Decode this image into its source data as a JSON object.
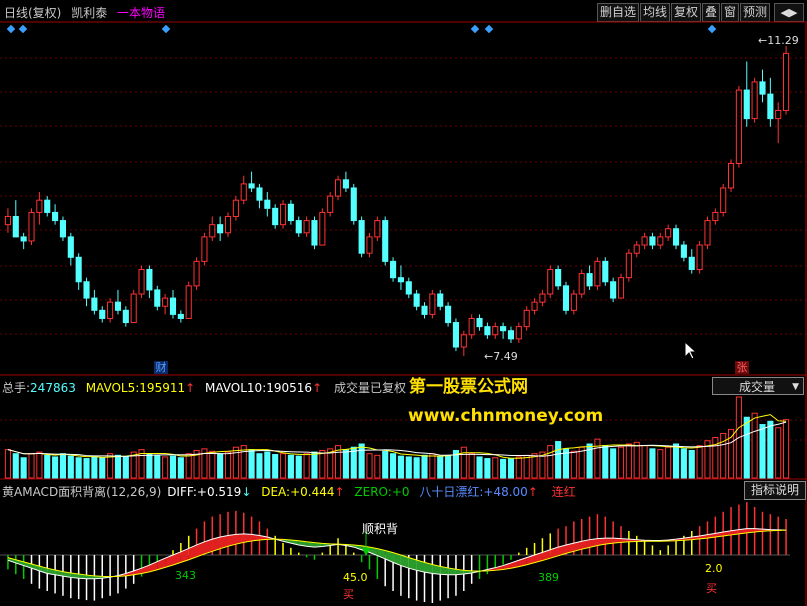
{
  "title": {
    "period": "日线(复权)",
    "stock": "凯利泰",
    "slogan": "一本物语"
  },
  "toolbar": [
    "删自选",
    "均线",
    "复权",
    "叠",
    "窗",
    "预测"
  ],
  "price": {
    "high_label": "11.29",
    "low_label": "7.49",
    "event_cai": "财",
    "event_zhang": "张"
  },
  "volume_info": {
    "total_label": "总手:",
    "total": "247863",
    "ma5_label": "MAVOL5:",
    "ma5": "195911",
    "ma10_label": "MAVOL10:",
    "ma10": "190516",
    "note": "成交量已复权",
    "selector": "成交量"
  },
  "indicator_info": {
    "name": "黄AMACD面积背离(12,26,9)",
    "diff_label": "DIFF:",
    "diff": "+0.519",
    "dea_label": "DEA:",
    "dea": "+0.444",
    "zero_label": "ZERO:",
    "zero": "+0",
    "red_label": "八十日漂红:",
    "red": "+48.00",
    "lianhong": "连红",
    "help": "指标说明"
  },
  "macd_labels": {
    "shunjibei": "顺积背",
    "a343": "343",
    "a45": "45.0",
    "a389": "389",
    "a2": "2.0",
    "mai": "买",
    "mai2": "买"
  },
  "watermark": {
    "name": "第一股票公式网",
    "url": "www.chnmoney.com"
  },
  "colors": {
    "up": "#ff3232",
    "down": "#54ffff",
    "white": "#ffffff",
    "yellow": "#ffff00",
    "magenta": "#ff00ff",
    "grid": "#6e0000"
  },
  "chart_data": {
    "type": "candlestick",
    "price_range": [
      7.49,
      11.29
    ],
    "candles": [
      [
        9.1,
        9.3,
        9.0,
        9.2
      ],
      [
        9.2,
        9.4,
        9.1,
        8.95
      ],
      [
        8.95,
        9.0,
        8.8,
        8.9
      ],
      [
        8.9,
        9.3,
        8.85,
        9.25
      ],
      [
        9.25,
        9.5,
        9.1,
        9.4
      ],
      [
        9.4,
        9.45,
        9.2,
        9.25
      ],
      [
        9.25,
        9.35,
        9.1,
        9.15
      ],
      [
        9.15,
        9.2,
        8.9,
        8.95
      ],
      [
        8.95,
        9.0,
        8.6,
        8.7
      ],
      [
        8.7,
        8.75,
        8.3,
        8.4
      ],
      [
        8.4,
        8.45,
        8.1,
        8.2
      ],
      [
        8.2,
        8.3,
        8.0,
        8.05
      ],
      [
        8.05,
        8.1,
        7.9,
        7.95
      ],
      [
        7.95,
        8.2,
        7.9,
        8.15
      ],
      [
        8.15,
        8.3,
        8.0,
        8.05
      ],
      [
        8.05,
        8.1,
        7.85,
        7.9
      ],
      [
        7.9,
        8.3,
        7.9,
        8.25
      ],
      [
        8.25,
        8.6,
        8.2,
        8.55
      ],
      [
        8.55,
        8.6,
        8.2,
        8.3
      ],
      [
        8.3,
        8.35,
        8.05,
        8.1
      ],
      [
        8.1,
        8.25,
        8.0,
        8.2
      ],
      [
        8.2,
        8.3,
        7.95,
        8.0
      ],
      [
        8.0,
        8.05,
        7.9,
        7.95
      ],
      [
        7.95,
        8.4,
        7.95,
        8.35
      ],
      [
        8.35,
        8.7,
        8.3,
        8.65
      ],
      [
        8.65,
        9.0,
        8.6,
        8.95
      ],
      [
        8.95,
        9.2,
        8.9,
        9.1
      ],
      [
        9.1,
        9.2,
        8.9,
        9.0
      ],
      [
        9.0,
        9.25,
        8.95,
        9.2
      ],
      [
        9.2,
        9.45,
        9.15,
        9.4
      ],
      [
        9.4,
        9.7,
        9.35,
        9.6
      ],
      [
        9.6,
        9.75,
        9.5,
        9.55
      ],
      [
        9.55,
        9.6,
        9.3,
        9.4
      ],
      [
        9.4,
        9.5,
        9.2,
        9.3
      ],
      [
        9.3,
        9.35,
        9.05,
        9.1
      ],
      [
        9.1,
        9.4,
        9.05,
        9.35
      ],
      [
        9.35,
        9.4,
        9.1,
        9.15
      ],
      [
        9.15,
        9.2,
        8.95,
        9.0
      ],
      [
        9.0,
        9.2,
        8.95,
        9.15
      ],
      [
        9.15,
        9.2,
        8.8,
        8.85
      ],
      [
        8.85,
        9.3,
        8.85,
        9.25
      ],
      [
        9.25,
        9.5,
        9.2,
        9.45
      ],
      [
        9.45,
        9.7,
        9.4,
        9.65
      ],
      [
        9.65,
        9.75,
        9.5,
        9.55
      ],
      [
        9.55,
        9.6,
        9.1,
        9.15
      ],
      [
        9.15,
        9.2,
        8.7,
        8.75
      ],
      [
        8.75,
        9.0,
        8.7,
        8.95
      ],
      [
        8.95,
        9.2,
        8.9,
        9.15
      ],
      [
        9.15,
        9.2,
        8.6,
        8.65
      ],
      [
        8.65,
        8.7,
        8.4,
        8.45
      ],
      [
        8.45,
        8.6,
        8.3,
        8.4
      ],
      [
        8.4,
        8.45,
        8.2,
        8.25
      ],
      [
        8.25,
        8.3,
        8.05,
        8.1
      ],
      [
        8.1,
        8.15,
        7.95,
        8.0
      ],
      [
        8.0,
        8.3,
        7.95,
        8.25
      ],
      [
        8.25,
        8.3,
        8.05,
        8.1
      ],
      [
        8.1,
        8.15,
        7.85,
        7.9
      ],
      [
        7.9,
        7.95,
        7.55,
        7.6
      ],
      [
        7.6,
        7.8,
        7.49,
        7.75
      ],
      [
        7.75,
        8.0,
        7.7,
        7.95
      ],
      [
        7.95,
        8.0,
        7.8,
        7.85
      ],
      [
        7.85,
        7.9,
        7.7,
        7.75
      ],
      [
        7.75,
        7.9,
        7.7,
        7.85
      ],
      [
        7.85,
        7.9,
        7.7,
        7.8
      ],
      [
        7.8,
        7.85,
        7.65,
        7.7
      ],
      [
        7.7,
        7.9,
        7.65,
        7.85
      ],
      [
        7.85,
        8.1,
        7.8,
        8.05
      ],
      [
        8.05,
        8.2,
        8.0,
        8.15
      ],
      [
        8.15,
        8.3,
        8.1,
        8.25
      ],
      [
        8.25,
        8.6,
        8.2,
        8.55
      ],
      [
        8.55,
        8.6,
        8.3,
        8.35
      ],
      [
        8.35,
        8.4,
        8.0,
        8.05
      ],
      [
        8.05,
        8.3,
        8.0,
        8.25
      ],
      [
        8.25,
        8.55,
        8.2,
        8.5
      ],
      [
        8.5,
        8.6,
        8.3,
        8.35
      ],
      [
        8.35,
        8.7,
        8.3,
        8.65
      ],
      [
        8.65,
        8.7,
        8.35,
        8.4
      ],
      [
        8.4,
        8.45,
        8.15,
        8.2
      ],
      [
        8.2,
        8.5,
        8.2,
        8.45
      ],
      [
        8.45,
        8.8,
        8.4,
        8.75
      ],
      [
        8.75,
        8.9,
        8.7,
        8.85
      ],
      [
        8.85,
        9.0,
        8.8,
        8.95
      ],
      [
        8.95,
        9.0,
        8.8,
        8.85
      ],
      [
        8.85,
        9.0,
        8.8,
        8.95
      ],
      [
        8.95,
        9.1,
        8.9,
        9.05
      ],
      [
        9.05,
        9.1,
        8.8,
        8.85
      ],
      [
        8.85,
        8.9,
        8.65,
        8.7
      ],
      [
        8.7,
        8.8,
        8.5,
        8.55
      ],
      [
        8.55,
        8.9,
        8.5,
        8.85
      ],
      [
        8.85,
        9.2,
        8.8,
        9.15
      ],
      [
        9.15,
        9.3,
        9.1,
        9.25
      ],
      [
        9.25,
        9.6,
        9.2,
        9.55
      ],
      [
        9.55,
        9.9,
        9.5,
        9.85
      ],
      [
        9.85,
        10.8,
        9.8,
        10.75
      ],
      [
        10.75,
        11.1,
        10.3,
        10.4
      ],
      [
        10.4,
        10.9,
        10.35,
        10.85
      ],
      [
        10.85,
        11.0,
        10.6,
        10.7
      ],
      [
        10.7,
        10.9,
        10.3,
        10.4
      ],
      [
        10.4,
        10.6,
        10.1,
        10.5
      ],
      [
        10.5,
        11.29,
        10.45,
        11.2
      ]
    ],
    "volumes": [
      0.35,
      0.3,
      0.25,
      0.3,
      0.32,
      0.28,
      0.26,
      0.3,
      0.27,
      0.25,
      0.24,
      0.26,
      0.25,
      0.3,
      0.28,
      0.26,
      0.32,
      0.35,
      0.3,
      0.28,
      0.26,
      0.27,
      0.25,
      0.3,
      0.34,
      0.36,
      0.33,
      0.3,
      0.32,
      0.38,
      0.4,
      0.35,
      0.3,
      0.32,
      0.29,
      0.3,
      0.28,
      0.27,
      0.3,
      0.32,
      0.34,
      0.36,
      0.4,
      0.35,
      0.38,
      0.42,
      0.3,
      0.28,
      0.33,
      0.3,
      0.27,
      0.26,
      0.25,
      0.28,
      0.3,
      0.26,
      0.28,
      0.34,
      0.38,
      0.3,
      0.26,
      0.24,
      0.25,
      0.23,
      0.24,
      0.26,
      0.28,
      0.3,
      0.32,
      0.4,
      0.45,
      0.36,
      0.33,
      0.38,
      0.42,
      0.48,
      0.4,
      0.36,
      0.38,
      0.42,
      0.44,
      0.4,
      0.36,
      0.35,
      0.38,
      0.42,
      0.36,
      0.34,
      0.4,
      0.46,
      0.5,
      0.55,
      0.6,
      1.0,
      0.75,
      0.8,
      0.66,
      0.7,
      0.62,
      0.72
    ],
    "macd_hist": [
      -0.3,
      -0.4,
      -0.5,
      -0.6,
      -0.7,
      -0.75,
      -0.8,
      -0.85,
      -0.9,
      -0.92,
      -0.94,
      -0.95,
      -0.9,
      -0.85,
      -0.8,
      -0.7,
      -0.6,
      -0.45,
      -0.3,
      -0.15,
      0.0,
      0.1,
      0.25,
      0.4,
      0.55,
      0.7,
      0.8,
      0.85,
      0.9,
      0.92,
      0.88,
      0.8,
      0.7,
      0.55,
      0.4,
      0.25,
      0.15,
      0.05,
      -0.05,
      -0.1,
      0.05,
      0.2,
      0.35,
      0.2,
      0.05,
      -0.15,
      -0.3,
      -0.5,
      -0.65,
      -0.75,
      -0.85,
      -0.9,
      -0.95,
      -0.98,
      -1.0,
      -0.95,
      -0.9,
      -0.85,
      -0.75,
      -0.6,
      -0.5,
      -0.4,
      -0.3,
      -0.2,
      -0.1,
      0.05,
      0.15,
      0.25,
      0.35,
      0.45,
      0.55,
      0.6,
      0.7,
      0.75,
      0.8,
      0.85,
      0.8,
      0.7,
      0.6,
      0.5,
      0.4,
      0.3,
      0.2,
      0.1,
      0.2,
      0.3,
      0.4,
      0.5,
      0.6,
      0.7,
      0.8,
      0.9,
      1.0,
      1.05,
      1.1,
      1.0,
      0.9,
      0.85,
      0.8,
      0.75
    ],
    "diff": [
      -0.2,
      -0.3,
      -0.4,
      -0.5,
      -0.6,
      -0.7,
      -0.75,
      -0.8,
      -0.85,
      -0.88,
      -0.9,
      -0.9,
      -0.88,
      -0.84,
      -0.78,
      -0.7,
      -0.6,
      -0.5,
      -0.38,
      -0.25,
      -0.12,
      0.0,
      0.12,
      0.25,
      0.38,
      0.5,
      0.6,
      0.68,
      0.74,
      0.78,
      0.8,
      0.78,
      0.74,
      0.68,
      0.6,
      0.52,
      0.45,
      0.38,
      0.33,
      0.3,
      0.32,
      0.36,
      0.4,
      0.36,
      0.3,
      0.2,
      0.1,
      -0.02,
      -0.15,
      -0.28,
      -0.4,
      -0.5,
      -0.58,
      -0.65,
      -0.7,
      -0.73,
      -0.75,
      -0.75,
      -0.72,
      -0.68,
      -0.62,
      -0.55,
      -0.48,
      -0.4,
      -0.3,
      -0.2,
      -0.1,
      0.0,
      0.1,
      0.2,
      0.3,
      0.38,
      0.45,
      0.52,
      0.58,
      0.62,
      0.64,
      0.64,
      0.62,
      0.6,
      0.58,
      0.56,
      0.55,
      0.55,
      0.57,
      0.6,
      0.64,
      0.68,
      0.72,
      0.77,
      0.82,
      0.87,
      0.92,
      0.96,
      1.0,
      1.0,
      0.98,
      0.96,
      0.95,
      0.94
    ],
    "dea": [
      -0.1,
      -0.18,
      -0.26,
      -0.34,
      -0.42,
      -0.5,
      -0.57,
      -0.63,
      -0.68,
      -0.72,
      -0.76,
      -0.79,
      -0.81,
      -0.82,
      -0.81,
      -0.79,
      -0.75,
      -0.7,
      -0.64,
      -0.56,
      -0.47,
      -0.38,
      -0.28,
      -0.18,
      -0.07,
      0.04,
      0.14,
      0.24,
      0.33,
      0.41,
      0.48,
      0.53,
      0.57,
      0.59,
      0.6,
      0.59,
      0.57,
      0.54,
      0.5,
      0.47,
      0.44,
      0.42,
      0.41,
      0.4,
      0.38,
      0.35,
      0.3,
      0.24,
      0.17,
      0.09,
      0.0,
      -0.1,
      -0.19,
      -0.28,
      -0.36,
      -0.43,
      -0.49,
      -0.54,
      -0.58,
      -0.6,
      -0.61,
      -0.6,
      -0.58,
      -0.55,
      -0.5,
      -0.44,
      -0.37,
      -0.29,
      -0.21,
      -0.12,
      -0.03,
      0.06,
      0.14,
      0.22,
      0.29,
      0.36,
      0.41,
      0.45,
      0.48,
      0.5,
      0.51,
      0.52,
      0.52,
      0.52,
      0.53,
      0.54,
      0.56,
      0.58,
      0.61,
      0.64,
      0.68,
      0.72,
      0.76,
      0.8,
      0.84,
      0.87,
      0.9,
      0.92,
      0.93,
      0.94
    ]
  }
}
